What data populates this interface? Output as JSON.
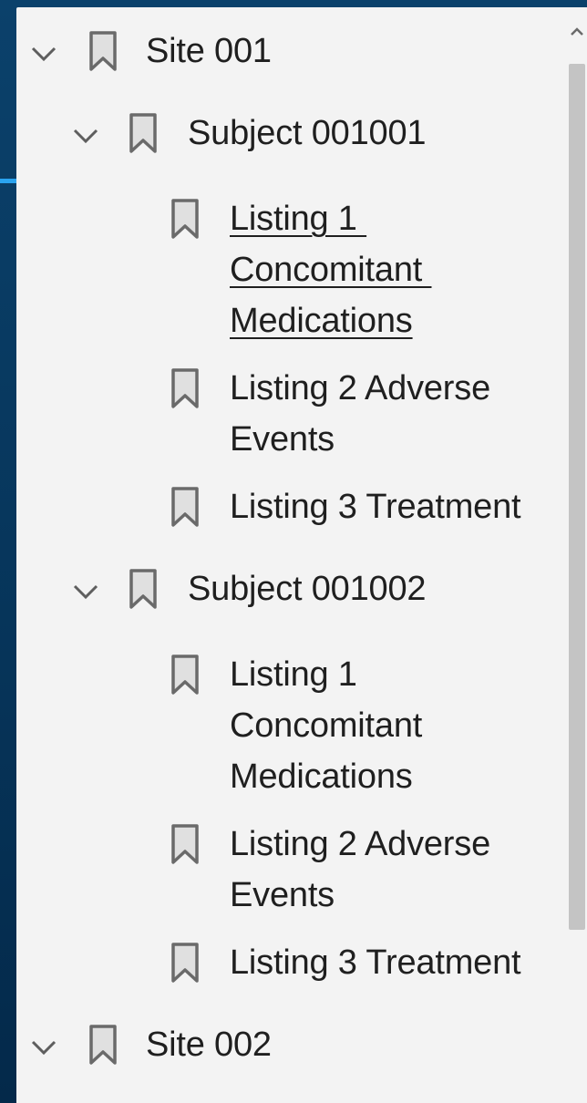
{
  "tree": {
    "site1": {
      "label": "Site 001",
      "subject1": {
        "label": "Subject 001001",
        "items": [
          {
            "label": "Listing 1 \nConcomitant \nMedications"
          },
          {
            "label": "Listing 2 Adverse\nEvents"
          },
          {
            "label": "Listing 3 Treatment"
          }
        ]
      },
      "subject2": {
        "label": "Subject 001002",
        "items": [
          {
            "label": "Listing 1\nConcomitant\nMedications"
          },
          {
            "label": "Listing 2 Adverse\nEvents"
          },
          {
            "label": "Listing 3 Treatment"
          }
        ]
      }
    },
    "site2": {
      "label": "Site 002"
    }
  },
  "icons": {
    "expand": "chevron-down-icon",
    "bookmark": "bookmark-icon",
    "scroll_up": "chevron-up-icon"
  },
  "colors": {
    "background": "#063459",
    "panel": "#f3f3f3",
    "accent": "#2aa3ef",
    "text": "#1f1f1f",
    "icon": "#6a6a6a",
    "scroll_thumb": "#c4c4c4"
  }
}
